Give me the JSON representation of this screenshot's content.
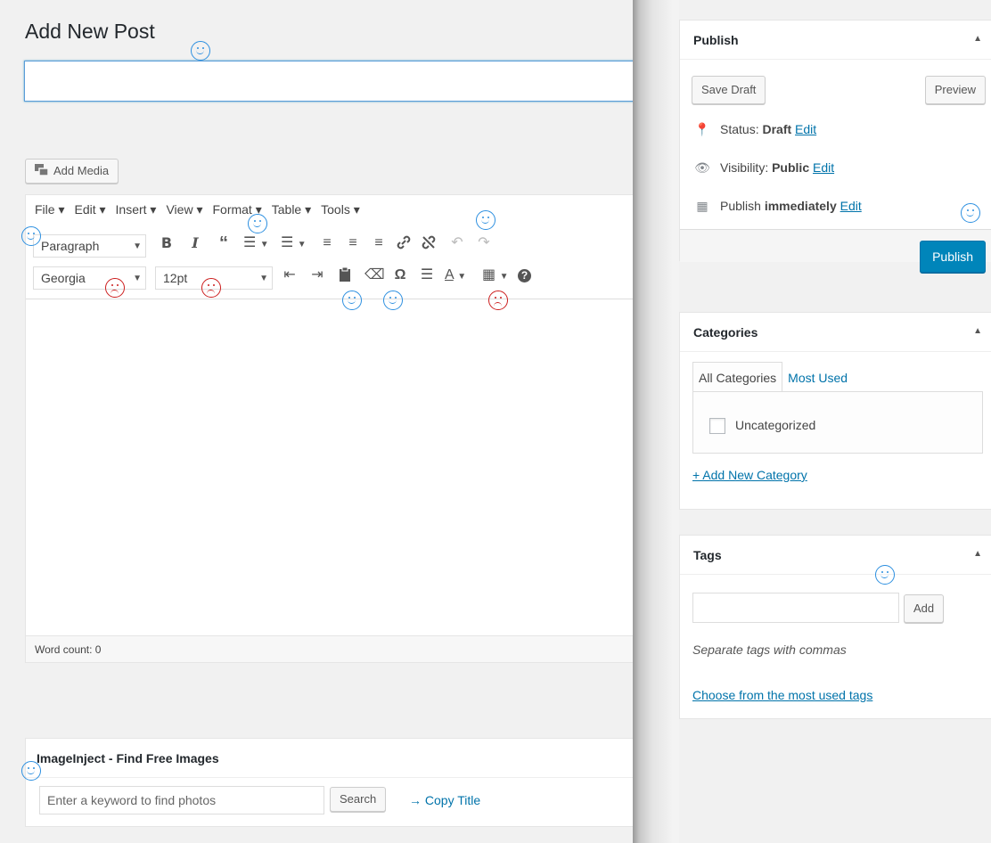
{
  "page": {
    "title": "Add New Post"
  },
  "editor": {
    "add_media_label": "Add Media",
    "menu": [
      "File ▾",
      "Edit ▾",
      "Insert ▾",
      "View ▾",
      "Format ▾",
      "Table ▾",
      "Tools ▾"
    ],
    "block_format": "Paragraph",
    "font_family": "Georgia",
    "font_size": "12pt",
    "word_count": "Word count: 0",
    "toolbar_row1": [
      "bold-icon",
      "italic-icon",
      "blockquote-icon",
      "bulleted-list-icon",
      "numbered-list-icon",
      "align-left-icon",
      "align-center-icon",
      "align-right-icon",
      "link-icon",
      "unlink-icon",
      "undo-icon",
      "redo-icon"
    ],
    "toolbar_row2": [
      "outdent-icon",
      "indent-icon",
      "paste-icon",
      "clear-formatting-icon",
      "special-character-icon",
      "horizontal-line-icon",
      "text-color-icon",
      "table-icon",
      "help-icon"
    ]
  },
  "imageinject": {
    "title": "ImageInject - Find Free Images",
    "placeholder": "Enter a keyword to find photos",
    "search_label": "Search",
    "copy_title": "→ Copy Title"
  },
  "publish": {
    "title": "Publish",
    "save_draft": "Save Draft",
    "preview": "Preview",
    "status_label": "Status:",
    "status_value": "Draft",
    "visibility_label": "Visibility:",
    "visibility_value": "Public",
    "publish_label": "Publish",
    "publish_value": "immediately",
    "edit": "Edit",
    "publish_button": "Publish"
  },
  "categories": {
    "title": "Categories",
    "tab_all": "All Categories",
    "tab_most_used": "Most Used",
    "items": [
      "Uncategorized"
    ],
    "add_new": "+ Add New Category"
  },
  "tags": {
    "title": "Tags",
    "add_label": "Add",
    "hint": "Separate tags with commas",
    "choose": "Choose from the most used tags"
  },
  "colors": {
    "primary": "#0085ba",
    "link": "#0073aa",
    "annotation_good": "#2c8fe0",
    "annotation_bad": "#cc1d1d"
  }
}
